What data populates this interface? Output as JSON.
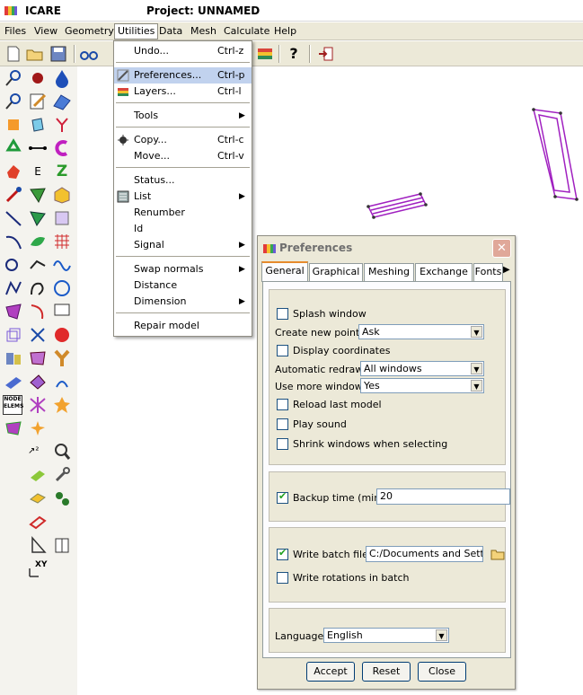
{
  "window": {
    "app_name": "ICARE",
    "project_title": "Project: UNNAMED"
  },
  "menubar": [
    "Files",
    "View",
    "Geometry",
    "Utilities",
    "Data",
    "Mesh",
    "Calculate",
    "Help"
  ],
  "utilities_menu": {
    "items": [
      {
        "label": "Undo...",
        "shortcut": "Ctrl-z",
        "icon": "undo-icon"
      },
      {
        "label": "Preferences...",
        "shortcut": "Ctrl-p",
        "icon": "preferences-icon",
        "highlighted": true
      },
      {
        "label": "Layers...",
        "shortcut": "Ctrl-l",
        "icon": "layers-icon"
      },
      {
        "label": "Tools",
        "submenu": true
      },
      {
        "label": "Copy...",
        "shortcut": "Ctrl-c",
        "icon": "copy-icon"
      },
      {
        "label": "Move...",
        "shortcut": "Ctrl-v"
      },
      {
        "label": "Status..."
      },
      {
        "label": "List",
        "submenu": true,
        "icon": "list-icon"
      },
      {
        "label": "Renumber"
      },
      {
        "label": "Id"
      },
      {
        "label": "Signal",
        "submenu": true
      },
      {
        "label": "Swap normals",
        "submenu": true
      },
      {
        "label": "Distance"
      },
      {
        "label": "Dimension",
        "submenu": true
      },
      {
        "label": "Repair model"
      }
    ]
  },
  "preferences": {
    "title": "Preferences",
    "close_glyph": "✕",
    "tabs": [
      "General",
      "Graphical",
      "Meshing",
      "Exchange",
      "Fonts"
    ],
    "active_tab": "General",
    "general": {
      "splash_window": {
        "label": "Splash window",
        "checked": false
      },
      "create_new_point": {
        "label": "Create new point:",
        "value": "Ask"
      },
      "display_coordinates": {
        "label": "Display coordinates",
        "checked": false
      },
      "automatic_redraw": {
        "label": "Automatic redraw:",
        "value": "All windows"
      },
      "use_more_windows": {
        "label": "Use more windows:",
        "value": "Yes"
      },
      "reload_last_model": {
        "label": "Reload last model",
        "checked": false
      },
      "play_sound": {
        "label": "Play sound",
        "checked": false
      },
      "shrink_windows": {
        "label": "Shrink windows when selecting",
        "checked": false
      },
      "backup_time": {
        "label": "Backup time (min):",
        "checked": true,
        "value": "20"
      },
      "write_batch_file": {
        "label": "Write batch file:",
        "checked": true,
        "value": "C:/Documents and Settings"
      },
      "write_rotations": {
        "label": "Write rotations in batch",
        "checked": false
      },
      "language": {
        "label": "Language:",
        "value": "English"
      }
    },
    "buttons": {
      "accept": "Accept",
      "reset": "Reset",
      "close": "Close"
    }
  },
  "palette_labels": {
    "node_elems": [
      "NODE",
      "ELEMS"
    ],
    "xy": "XY",
    "e_label": "E",
    "z_label": "Z"
  },
  "colors": {
    "menu_highlight": "#c1d2ee",
    "window_bg": "#ece9d8",
    "model_purple": "#a020c0",
    "tab_accent": "#e68b2c"
  }
}
